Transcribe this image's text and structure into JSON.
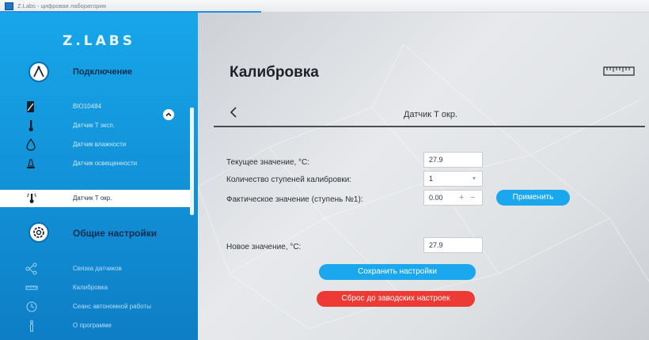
{
  "window": {
    "title": "Z.Labs - цифровая лаборатория"
  },
  "sidebar": {
    "logo": "Z.LABS",
    "connection": {
      "title": "Подключение",
      "items": [
        {
          "label": "BIO10484",
          "icon": "device-icon"
        },
        {
          "label": "Датчик Т эксп.",
          "icon": "thermometer-icon"
        },
        {
          "label": "Датчик влажности",
          "icon": "drop-icon"
        },
        {
          "label": "Датчик освещенности",
          "icon": "lamp-icon"
        },
        {
          "label": "Датчик Т окр.",
          "icon": "thermometer-sun-icon",
          "active": true
        }
      ]
    },
    "settings": {
      "title": "Общие настройки",
      "items": [
        {
          "label": "Связка датчиков",
          "icon": "link-nodes-icon"
        },
        {
          "label": "Калибровка",
          "icon": "ruler-icon"
        },
        {
          "label": "Сеанс автономной работы",
          "icon": "clock-icon"
        },
        {
          "label": "О программе",
          "icon": "info-icon"
        }
      ]
    }
  },
  "main": {
    "title": "Калибровка",
    "sensor_title": "Датчик Т окр.",
    "current_value_label": "Текущее значение, °C:",
    "current_value": "27.9",
    "steps_label": "Количество ступеней калибровки:",
    "steps_value": "1",
    "actual_label": "Фактическое значение (ступень №1):",
    "actual_value": "0.00",
    "plus": "+",
    "minus": "−",
    "apply_button": "Применить",
    "new_value_label": "Новое значение, °C:",
    "new_value": "27.9",
    "save_button": "Сохранить настройки",
    "reset_button": "Сброс до заводских настроек"
  },
  "colors": {
    "sidebar": "#1598dd",
    "accent": "#1aa7ee",
    "danger": "#ee3a34",
    "title_text": "#0b2d52"
  }
}
